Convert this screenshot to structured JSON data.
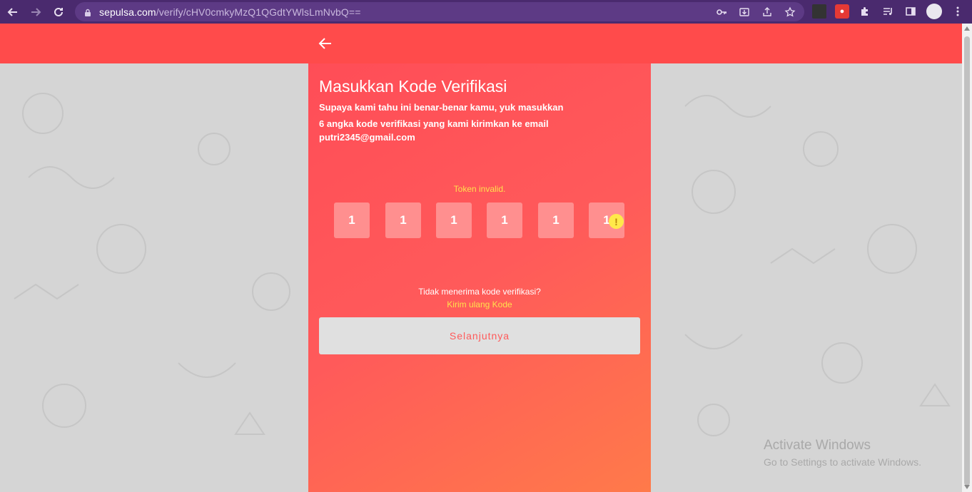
{
  "browser": {
    "url_host": "sepulsa.com",
    "url_path": "/verify/cHV0cmkyMzQ1QGdtYWlsLmNvbQ=="
  },
  "page": {
    "title": "Masukkan Kode Verifikasi",
    "subtitle": "Supaya kami tahu ini benar-benar kamu, yuk masukkan 6 angka kode verifikasi yang kami kirimkan ke email",
    "email": "putri2345@gmail.com",
    "error": "Token invalid.",
    "otp_digits": [
      "1",
      "1",
      "1",
      "1",
      "1",
      "1"
    ],
    "resend_question": "Tidak menerima kode verifikasi?",
    "resend_link": "Kirim ulang Kode",
    "next_button": "Selanjutnya"
  },
  "watermark": {
    "title": "Activate Windows",
    "subtitle": "Go to Settings to activate Windows."
  },
  "colors": {
    "header": "#ff4b4b",
    "accent_yellow": "#ffe14d",
    "button_bg": "#e0e0e0",
    "button_text": "#ff5a5a"
  }
}
